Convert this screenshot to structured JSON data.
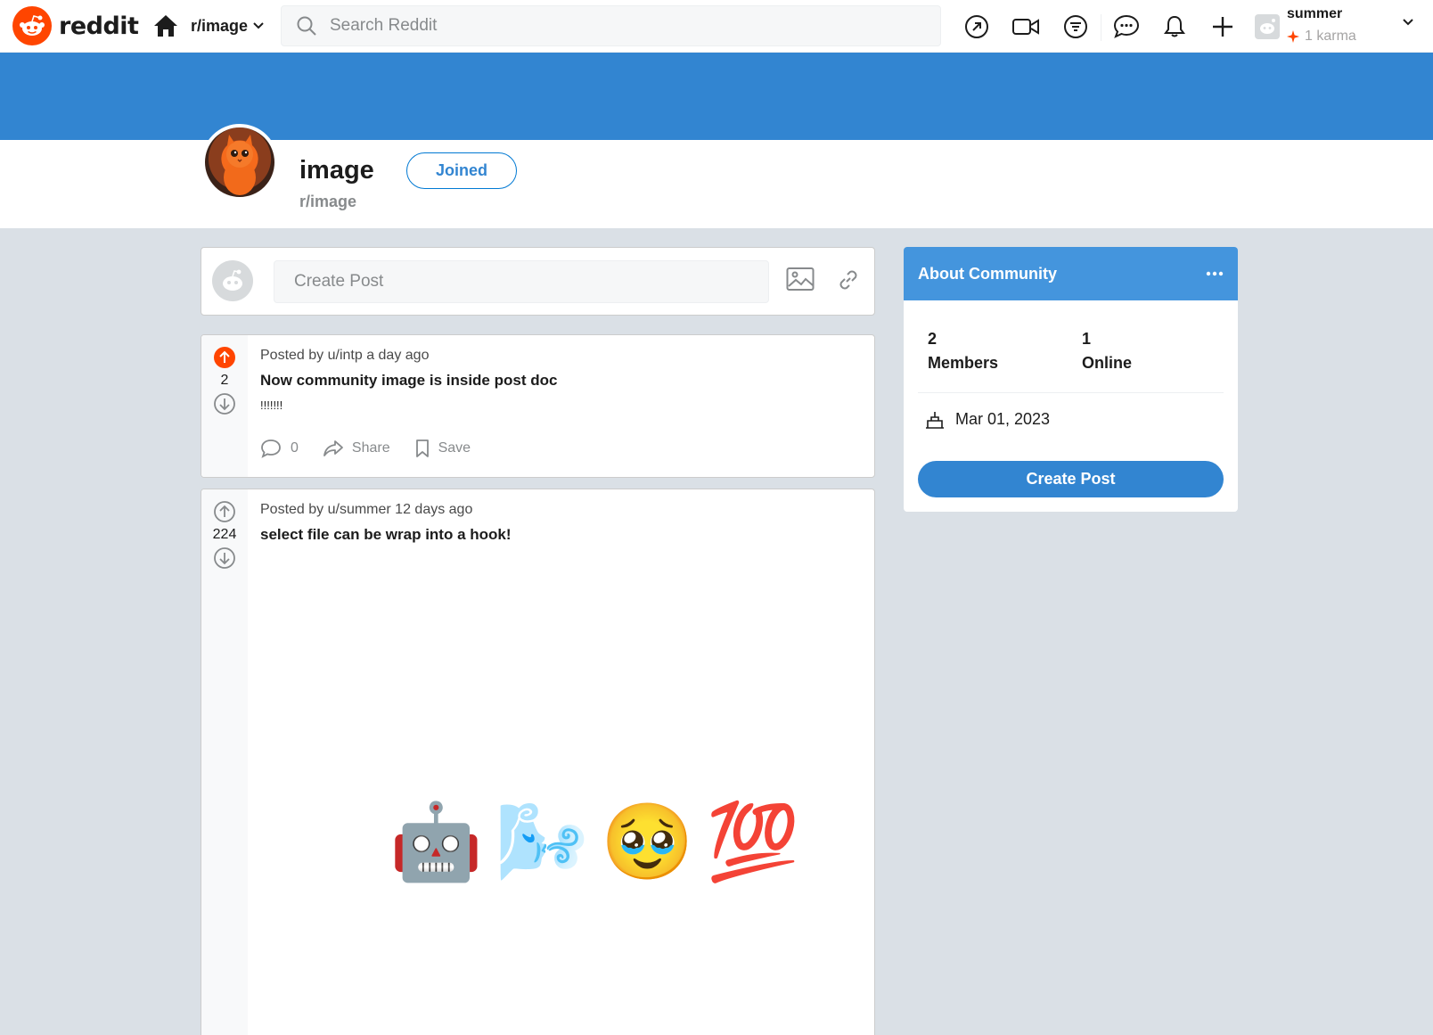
{
  "header": {
    "logo_text": "reddit",
    "current_community": "r/image",
    "search_placeholder": "Search Reddit",
    "user": {
      "name": "summer",
      "karma": "1 karma"
    }
  },
  "community": {
    "title": "image",
    "name": "r/image",
    "join_label": "Joined",
    "banner_color": "#3285d1"
  },
  "create_post": {
    "placeholder": "Create Post"
  },
  "posts": [
    {
      "meta": "Posted by u/intp a day ago",
      "votes": "2",
      "upvoted": true,
      "title": "Now community image is inside post doc",
      "text": "!!!!!!!",
      "comments": "0",
      "share_label": "Share",
      "save_label": "Save"
    },
    {
      "meta": "Posted by u/summer 12 days ago",
      "votes": "224",
      "upvoted": false,
      "title": "select file can be wrap into a hook!",
      "image_emojis": [
        "🤖",
        "🌬️",
        "🥹",
        "💯"
      ]
    }
  ],
  "about": {
    "title": "About Community",
    "members_count": "2",
    "members_label": "Members",
    "online_count": "1",
    "online_label": "Online",
    "created": "Mar 01, 2023",
    "create_post_label": "Create Post"
  },
  "colors": {
    "brand": "#ff4500",
    "accent": "#3285d1",
    "page_bg": "#dae0e6"
  }
}
